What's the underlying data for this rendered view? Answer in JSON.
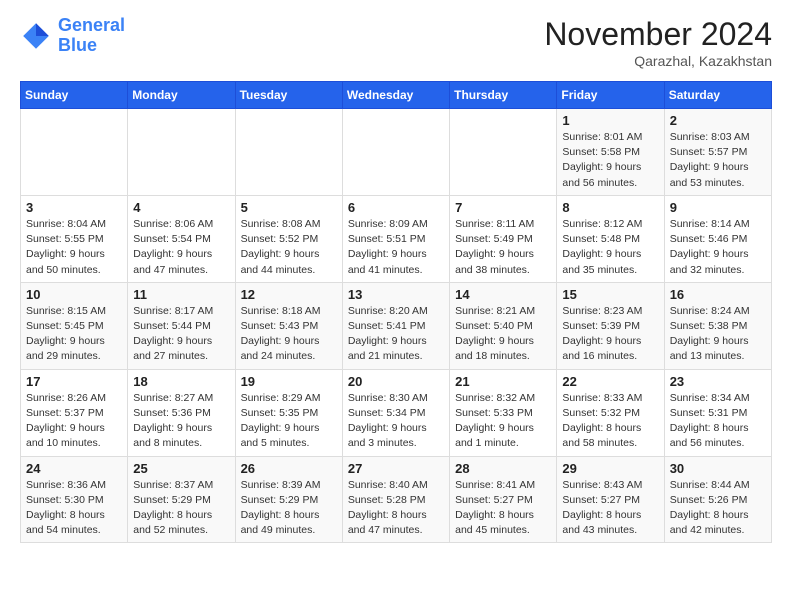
{
  "header": {
    "logo_line1": "General",
    "logo_line2": "Blue",
    "month_title": "November 2024",
    "location": "Qarazhal, Kazakhstan"
  },
  "weekdays": [
    "Sunday",
    "Monday",
    "Tuesday",
    "Wednesday",
    "Thursday",
    "Friday",
    "Saturday"
  ],
  "weeks": [
    [
      {
        "day": "",
        "info": ""
      },
      {
        "day": "",
        "info": ""
      },
      {
        "day": "",
        "info": ""
      },
      {
        "day": "",
        "info": ""
      },
      {
        "day": "",
        "info": ""
      },
      {
        "day": "1",
        "info": "Sunrise: 8:01 AM\nSunset: 5:58 PM\nDaylight: 9 hours and 56 minutes."
      },
      {
        "day": "2",
        "info": "Sunrise: 8:03 AM\nSunset: 5:57 PM\nDaylight: 9 hours and 53 minutes."
      }
    ],
    [
      {
        "day": "3",
        "info": "Sunrise: 8:04 AM\nSunset: 5:55 PM\nDaylight: 9 hours and 50 minutes."
      },
      {
        "day": "4",
        "info": "Sunrise: 8:06 AM\nSunset: 5:54 PM\nDaylight: 9 hours and 47 minutes."
      },
      {
        "day": "5",
        "info": "Sunrise: 8:08 AM\nSunset: 5:52 PM\nDaylight: 9 hours and 44 minutes."
      },
      {
        "day": "6",
        "info": "Sunrise: 8:09 AM\nSunset: 5:51 PM\nDaylight: 9 hours and 41 minutes."
      },
      {
        "day": "7",
        "info": "Sunrise: 8:11 AM\nSunset: 5:49 PM\nDaylight: 9 hours and 38 minutes."
      },
      {
        "day": "8",
        "info": "Sunrise: 8:12 AM\nSunset: 5:48 PM\nDaylight: 9 hours and 35 minutes."
      },
      {
        "day": "9",
        "info": "Sunrise: 8:14 AM\nSunset: 5:46 PM\nDaylight: 9 hours and 32 minutes."
      }
    ],
    [
      {
        "day": "10",
        "info": "Sunrise: 8:15 AM\nSunset: 5:45 PM\nDaylight: 9 hours and 29 minutes."
      },
      {
        "day": "11",
        "info": "Sunrise: 8:17 AM\nSunset: 5:44 PM\nDaylight: 9 hours and 27 minutes."
      },
      {
        "day": "12",
        "info": "Sunrise: 8:18 AM\nSunset: 5:43 PM\nDaylight: 9 hours and 24 minutes."
      },
      {
        "day": "13",
        "info": "Sunrise: 8:20 AM\nSunset: 5:41 PM\nDaylight: 9 hours and 21 minutes."
      },
      {
        "day": "14",
        "info": "Sunrise: 8:21 AM\nSunset: 5:40 PM\nDaylight: 9 hours and 18 minutes."
      },
      {
        "day": "15",
        "info": "Sunrise: 8:23 AM\nSunset: 5:39 PM\nDaylight: 9 hours and 16 minutes."
      },
      {
        "day": "16",
        "info": "Sunrise: 8:24 AM\nSunset: 5:38 PM\nDaylight: 9 hours and 13 minutes."
      }
    ],
    [
      {
        "day": "17",
        "info": "Sunrise: 8:26 AM\nSunset: 5:37 PM\nDaylight: 9 hours and 10 minutes."
      },
      {
        "day": "18",
        "info": "Sunrise: 8:27 AM\nSunset: 5:36 PM\nDaylight: 9 hours and 8 minutes."
      },
      {
        "day": "19",
        "info": "Sunrise: 8:29 AM\nSunset: 5:35 PM\nDaylight: 9 hours and 5 minutes."
      },
      {
        "day": "20",
        "info": "Sunrise: 8:30 AM\nSunset: 5:34 PM\nDaylight: 9 hours and 3 minutes."
      },
      {
        "day": "21",
        "info": "Sunrise: 8:32 AM\nSunset: 5:33 PM\nDaylight: 9 hours and 1 minute."
      },
      {
        "day": "22",
        "info": "Sunrise: 8:33 AM\nSunset: 5:32 PM\nDaylight: 8 hours and 58 minutes."
      },
      {
        "day": "23",
        "info": "Sunrise: 8:34 AM\nSunset: 5:31 PM\nDaylight: 8 hours and 56 minutes."
      }
    ],
    [
      {
        "day": "24",
        "info": "Sunrise: 8:36 AM\nSunset: 5:30 PM\nDaylight: 8 hours and 54 minutes."
      },
      {
        "day": "25",
        "info": "Sunrise: 8:37 AM\nSunset: 5:29 PM\nDaylight: 8 hours and 52 minutes."
      },
      {
        "day": "26",
        "info": "Sunrise: 8:39 AM\nSunset: 5:29 PM\nDaylight: 8 hours and 49 minutes."
      },
      {
        "day": "27",
        "info": "Sunrise: 8:40 AM\nSunset: 5:28 PM\nDaylight: 8 hours and 47 minutes."
      },
      {
        "day": "28",
        "info": "Sunrise: 8:41 AM\nSunset: 5:27 PM\nDaylight: 8 hours and 45 minutes."
      },
      {
        "day": "29",
        "info": "Sunrise: 8:43 AM\nSunset: 5:27 PM\nDaylight: 8 hours and 43 minutes."
      },
      {
        "day": "30",
        "info": "Sunrise: 8:44 AM\nSunset: 5:26 PM\nDaylight: 8 hours and 42 minutes."
      }
    ]
  ]
}
